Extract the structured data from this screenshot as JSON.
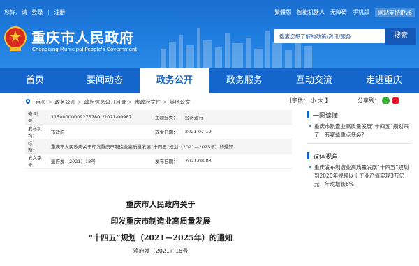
{
  "topbar": {
    "greeting": "您好,",
    "login_prompt": "请",
    "login": "登录",
    "divider": "|",
    "register": "注册",
    "links": [
      "繁體版",
      "智能机器人",
      "无障碍",
      "手机版"
    ],
    "ipv6": "网站支持IPv6"
  },
  "site": {
    "title": "重庆市人民政府",
    "subtitle": "Chongqing Municipal People's Government"
  },
  "search": {
    "placeholder": "搜索您想了解的政策/资讯/服务",
    "button": "搜索"
  },
  "nav": {
    "items": [
      "首页",
      "要闻动态",
      "政务公开",
      "政务服务",
      "互动交流",
      "走进重庆"
    ],
    "active_index": 2
  },
  "breadcrumb": {
    "items": [
      "首页",
      "政务公开",
      "政府信息公开目录",
      "市政府文件",
      "其他公文"
    ],
    "separator": ">"
  },
  "font_size": {
    "label": "【字体：",
    "small": "小",
    "large": "大",
    "close": "】"
  },
  "share": {
    "label": "分享到："
  },
  "info": {
    "index_label": "索 引 号：",
    "index_value": "11500000009275780L/2021-00987",
    "category_label": "主题分类：",
    "category_value": "经济运行",
    "issuer_label": "发布机构：",
    "issuer_value": "市政府",
    "date_label": "成文日期：",
    "date_value": "2021-07-19",
    "title_label": "标　　题：",
    "title_value": "重庆市人民政府关于印发重庆市制造业高质量发展“十四五”规划（2021—2025年）的通知",
    "docno_label": "发文字号：",
    "docno_value": "渝府发〔2021〕18号",
    "pubdate_label": "发布日期：",
    "pubdate_value": "2021-08-03"
  },
  "document": {
    "title_lines": [
      "重庆市人民政府关于",
      "印发重庆市制造业高质量发展",
      "“十四五”规划（2021—2025年）的通知"
    ],
    "number": "渝府发〔2021〕18号"
  },
  "sidebar": {
    "section1_title": "一图读懂",
    "section1_item": "重庆市制造业高质量发展“十四五”规划来了！有哪些重点任务？",
    "section2_title": "媒体视角",
    "section2_item": "重庆发布制造业高质量发展“十四五”规划 到2025年规模以上工业产值实现3万亿元，年均增长6%"
  },
  "colors": {
    "brand_blue": "#1466cc",
    "header_blue": "#1f7de0"
  }
}
